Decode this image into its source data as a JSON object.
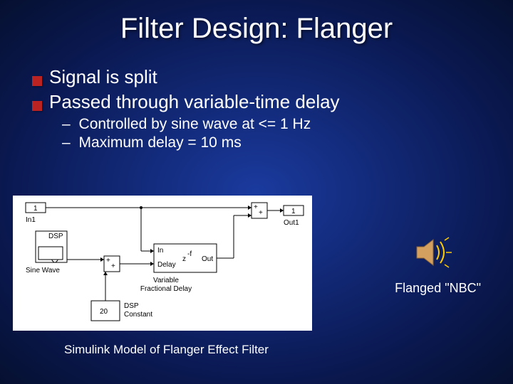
{
  "title": "Filter Design: Flanger",
  "bullets": [
    "Signal is split",
    "Passed through variable-time delay"
  ],
  "subbullets": [
    "Controlled by sine wave at <= 1 Hz",
    "Maximum delay = 10 ms"
  ],
  "diagram": {
    "in_port": "1",
    "in_label": "In1",
    "out_port": "1",
    "out_label": "Out1",
    "sine_box": "DSP",
    "sine_label": "Sine Wave",
    "constant_value": "20",
    "constant_label": "DSP\nConstant",
    "delay_in": "In",
    "delay_delay": "Delay",
    "delay_z": "z",
    "delay_exp": "-f",
    "delay_out": "Out",
    "delay_label": "Variable\nFractional Delay",
    "sum": "+",
    "caption": "Simulink Model of Flanger Effect Filter"
  },
  "audio_label": "Flanged \"NBC\""
}
